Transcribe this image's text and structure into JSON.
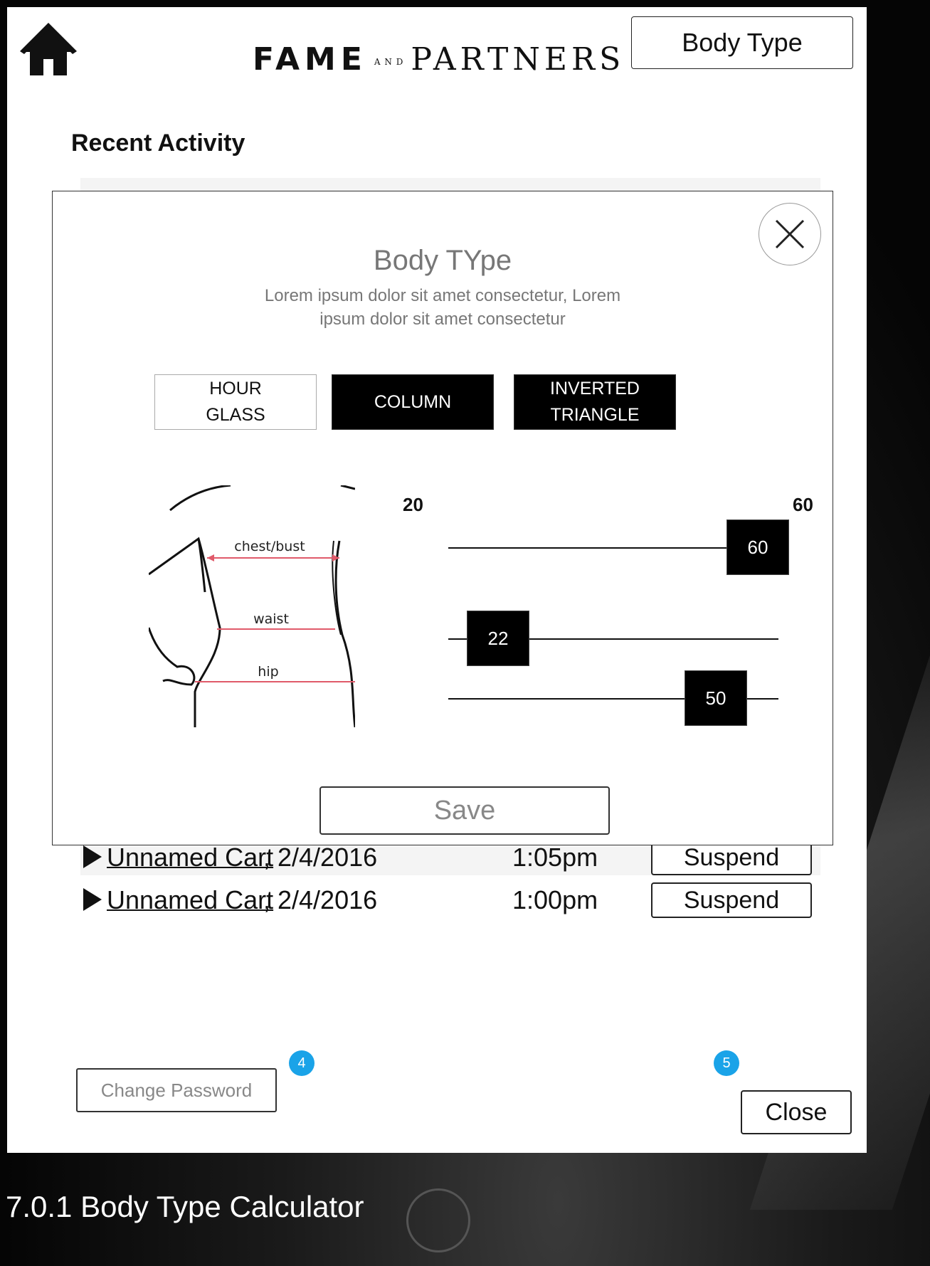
{
  "header": {
    "brand_left": "FAME",
    "brand_and": "A N D",
    "brand_right": "PARTNERS",
    "body_type_button": "Body Type"
  },
  "recent": {
    "title": "Recent Activity",
    "rows": [
      {
        "name": "Unnamed Cart",
        "date": ", 2/4/2016",
        "time": "1:05pm",
        "action": "Suspend"
      },
      {
        "name": "Unnamed Cart",
        "date": ", 2/4/2016",
        "time": "1:00pm",
        "action": "Suspend"
      }
    ]
  },
  "modal": {
    "title": "Body TYpe",
    "subtitle": "Lorem ipsum dolor sit amet consectetur, Lorem ipsum dolor sit amet consectetur",
    "types": [
      {
        "label": "HOUR GLASS",
        "selected": false
      },
      {
        "label": "COLUMN",
        "selected": true
      },
      {
        "label": "INVERTED TRIANGLE",
        "selected": true
      }
    ],
    "figure_labels": {
      "chest": "chest/bust",
      "waist": "waist",
      "hip": "hip"
    },
    "range_min": "20",
    "range_max": "60",
    "sliders": [
      {
        "name": "chest-bust",
        "value": 60
      },
      {
        "name": "waist",
        "value": 22
      },
      {
        "name": "hip",
        "value": 50
      }
    ],
    "save_label": "Save"
  },
  "footer": {
    "change_password": "Change Password",
    "badge_4": "4",
    "badge_5": "5",
    "close": "Close"
  },
  "caption": "7.0.1 Body Type Calculator",
  "colors": {
    "badge": "#1aa3e8",
    "selected_type": "#000000"
  }
}
